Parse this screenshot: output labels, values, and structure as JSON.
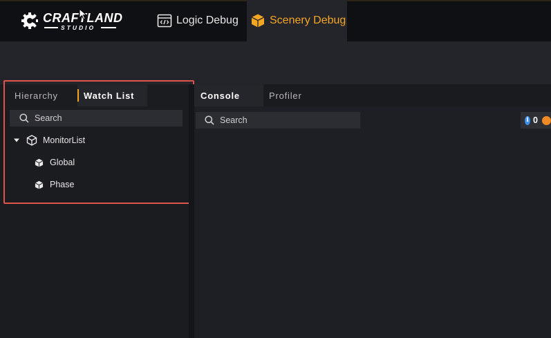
{
  "header": {
    "logo_main": "CRAFTLAND",
    "logo_sub": "STUDIO",
    "tabs": [
      {
        "label": "Logic Debug",
        "icon": "code-window-icon",
        "active": false
      },
      {
        "label": "Scenery Debug",
        "icon": "cube-icon",
        "active": true
      }
    ]
  },
  "left_panel": {
    "tabs": [
      {
        "label": "Hierarchy",
        "active": false
      },
      {
        "label": "Watch List",
        "active": true
      }
    ],
    "search_placeholder": "Search",
    "tree": [
      {
        "label": "MonitorList",
        "icon": "cube-outline-icon",
        "expanded": true,
        "level": 0
      },
      {
        "label": "Global",
        "icon": "cube-filled-icon",
        "level": 1
      },
      {
        "label": "Phase",
        "icon": "cube-filled-icon",
        "level": 1
      }
    ]
  },
  "right_panel": {
    "tabs": [
      {
        "label": "Console",
        "active": true
      },
      {
        "label": "Profiler",
        "active": false
      }
    ],
    "search_placeholder": "Search",
    "counters": {
      "info": "0"
    }
  },
  "colors": {
    "accent": "#f5a623",
    "highlight_border": "#e0544b",
    "info": "#3b8fe6",
    "warning": "#f08a24"
  }
}
